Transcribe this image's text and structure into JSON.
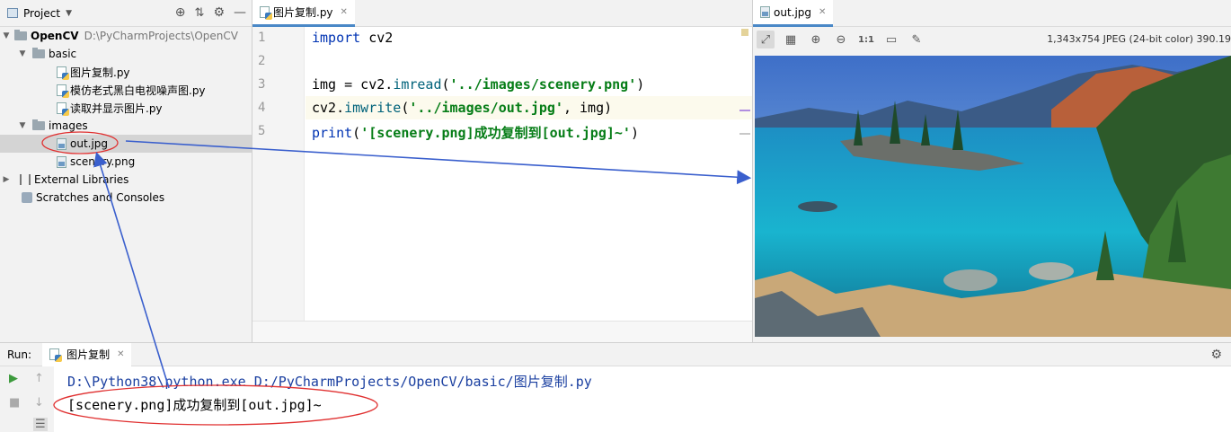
{
  "project": {
    "title": "Project",
    "root_name": "OpenCV",
    "root_path": "D:\\PyCharmProjects\\OpenCV",
    "items": [
      {
        "label": "basic"
      },
      {
        "label": "图片复制.py"
      },
      {
        "label": "模仿老式黑白电视噪声图.py"
      },
      {
        "label": "读取并显示图片.py"
      },
      {
        "label": "images"
      },
      {
        "label": "out.jpg"
      },
      {
        "label": "scenery.png"
      },
      {
        "label": "External Libraries"
      },
      {
        "label": "Scratches and Consoles"
      }
    ]
  },
  "editor": {
    "tab_label": "图片复制.py",
    "line_numbers": [
      "1",
      "2",
      "3",
      "4",
      "5"
    ],
    "code": {
      "l1_kw": "import",
      "l1_rest": " cv2",
      "l3_pre": "img = cv2.",
      "l3_fn": "imread",
      "l3_open": "(",
      "l3_str": "'../images/scenery.png'",
      "l3_close": ")",
      "l4_pre": "cv2.",
      "l4_fn": "imwrite",
      "l4_open": "(",
      "l4_str": "'../images/out.jpg'",
      "l4_close": ", img)",
      "l5_kw": "print",
      "l5_open": "(",
      "l5_str": "'[scenery.png]成功复制到[out.jpg]~'",
      "l5_close": ")"
    }
  },
  "viewer": {
    "tab_label": "out.jpg",
    "zoom_label": "1:1",
    "info": "1,343x754 JPEG (24-bit color) 390.19"
  },
  "run": {
    "label": "Run:",
    "tab_label": "图片复制",
    "output": [
      "D:\\Python38\\python.exe D:/PyCharmProjects/OpenCV/basic/图片复制.py",
      "[scenery.png]成功复制到[out.jpg]~"
    ]
  },
  "colors": {
    "keyword": "#0033b3",
    "string": "#067d17",
    "annotation": "#3a5fcd",
    "ellipse": "#e03030"
  }
}
